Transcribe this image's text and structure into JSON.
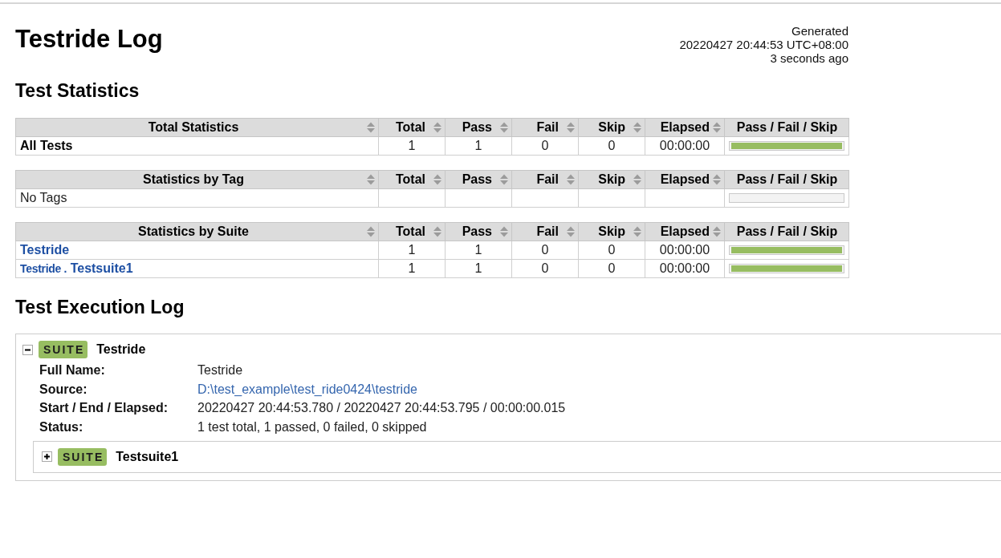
{
  "header": {
    "title": "Testride Log",
    "generated": [
      "Generated",
      "20220427 20:44:53 UTC+08:00",
      "3 seconds ago"
    ]
  },
  "statistics": {
    "heading": "Test Statistics",
    "tables": [
      {
        "columns": [
          {
            "label": "Total Statistics",
            "sortable": true
          },
          {
            "label": "Total",
            "sortable": true
          },
          {
            "label": "Pass",
            "sortable": true
          },
          {
            "label": "Fail",
            "sortable": true
          },
          {
            "label": "Skip",
            "sortable": true
          },
          {
            "label": "Elapsed",
            "sortable": true
          },
          {
            "label": "Pass / Fail / Skip",
            "sortable": false
          }
        ],
        "rows": [
          {
            "kind": "total",
            "cells": [
              "All Tests",
              "1",
              "1",
              "0",
              "0",
              "00:00:00"
            ],
            "level": 1
          }
        ]
      },
      {
        "columns": [
          {
            "label": "Statistics by Tag",
            "sortable": true
          },
          {
            "label": "Total",
            "sortable": true
          },
          {
            "label": "Pass",
            "sortable": true
          },
          {
            "label": "Fail",
            "sortable": true
          },
          {
            "label": "Skip",
            "sortable": true
          },
          {
            "label": "Elapsed",
            "sortable": true
          },
          {
            "label": "Pass / Fail / Skip",
            "sortable": false
          }
        ],
        "rows": [
          {
            "kind": "tag",
            "cells": [
              "No Tags"
            ]
          }
        ]
      },
      {
        "columns": [
          {
            "label": "Statistics by Suite",
            "sortable": true
          },
          {
            "label": "Total",
            "sortable": true
          },
          {
            "label": "Pass",
            "sortable": true
          },
          {
            "label": "Fail",
            "sortable": true
          },
          {
            "label": "Skip",
            "sortable": true
          },
          {
            "label": "Elapsed",
            "sortable": true
          },
          {
            "label": "Pass / Fail / Skip",
            "sortable": false
          }
        ],
        "rows": [
          {
            "kind": "suite",
            "cells": [
              "Testride",
              "1",
              "1",
              "0",
              "0",
              "00:00:00"
            ],
            "level": 1
          },
          {
            "kind": "suite",
            "parent": "Testride .",
            "cells": [
              "Testsuite1",
              "1",
              "1",
              "0",
              "0",
              "00:00:00"
            ],
            "level": 1
          }
        ]
      }
    ]
  },
  "execution_log": {
    "heading": "Test Execution Log",
    "suites": [
      {
        "badge": "SUITE",
        "name": "Testride",
        "expanded": true,
        "metadata": [
          {
            "label": "Full Name:",
            "value": "Testride",
            "kind": "text"
          },
          {
            "label": "Source:",
            "value": "D:\\test_example\\test_ride0424\\testride",
            "kind": "link"
          },
          {
            "label": "Start / End / Elapsed:",
            "value": "20220427 20:44:53.780 / 20220427 20:44:53.795 / 00:00:00.015",
            "kind": "text"
          },
          {
            "label": "Status:",
            "value": "1 test total, 1 passed, 0 failed, 0 skipped",
            "kind": "text"
          }
        ],
        "children": [
          {
            "badge": "SUITE",
            "name": "Testsuite1",
            "expanded": false
          }
        ]
      }
    ]
  }
}
